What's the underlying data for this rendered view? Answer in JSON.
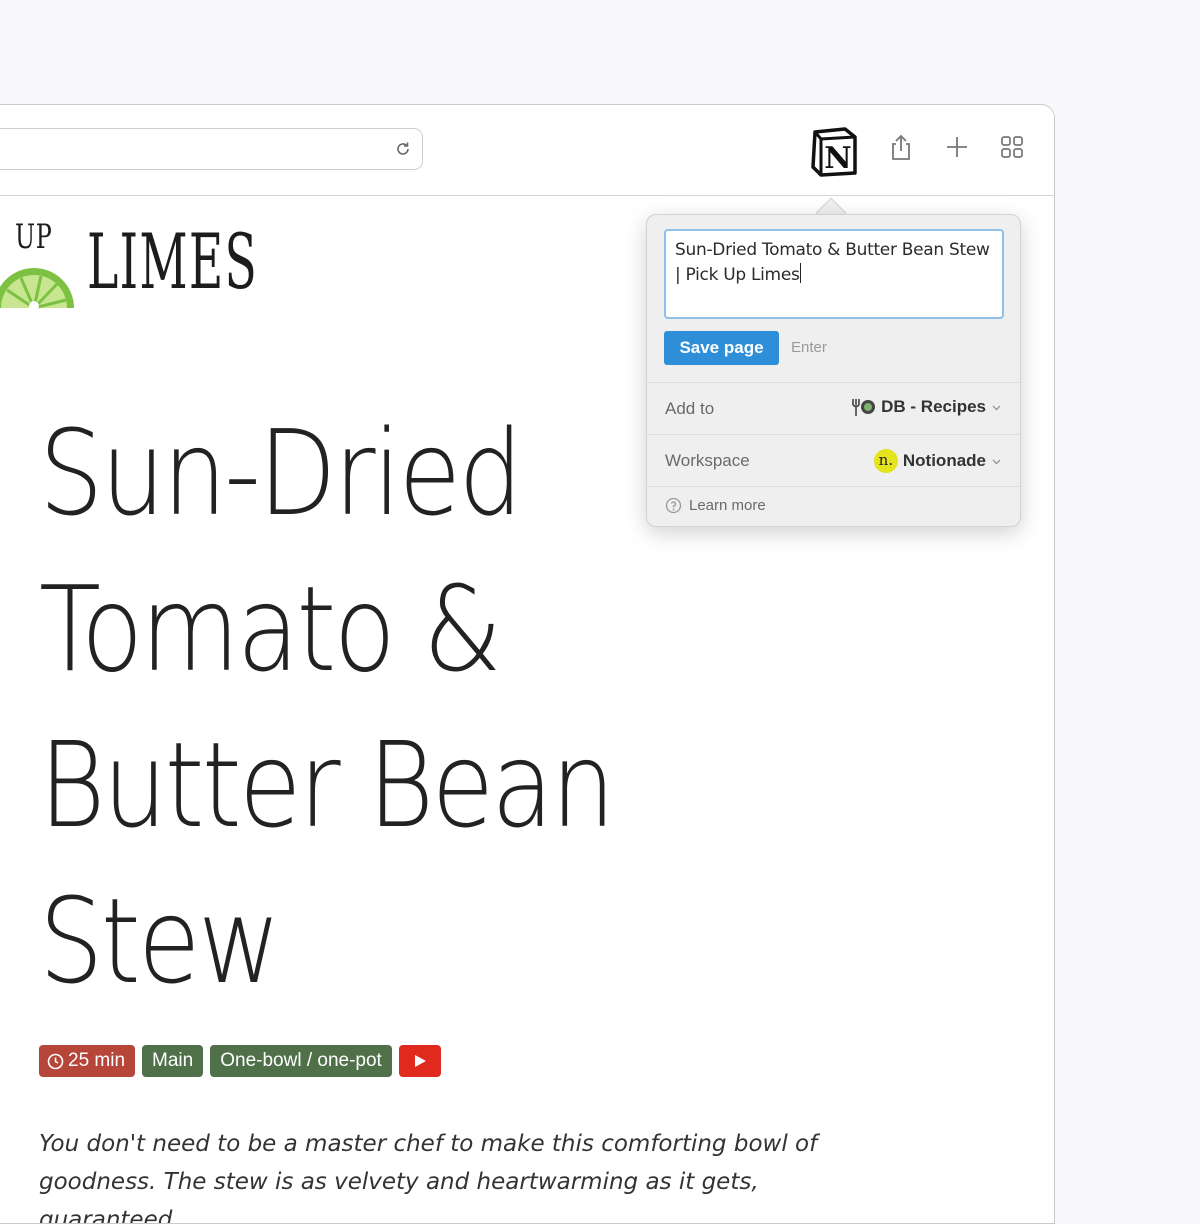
{
  "browser": {
    "toolbar_icons": [
      "reload-icon",
      "notion-icon",
      "share-icon",
      "plus-icon",
      "tab-overview-icon"
    ]
  },
  "page": {
    "logo": {
      "small": "UP",
      "large": "LIMES"
    },
    "title": "Sun-Dried Tomato & Butter Bean Stew",
    "tags": {
      "time": "25 min",
      "course": "Main",
      "style": "One-bowl / one-pot"
    },
    "intro": "You don't need to be a master chef to make this comforting bowl of goodness. The stew is as velvety and heartwarming as it gets, guaranteed"
  },
  "clipper": {
    "title_value": "Sun-Dried Tomato & Butter Bean Stew | Pick Up Limes",
    "save_label": "Save page",
    "enter_hint": "Enter",
    "add_to_label": "Add to",
    "add_to_value": "DB - Recipes",
    "workspace_label": "Workspace",
    "workspace_value": "Notionade",
    "workspace_avatar": "n.",
    "learn_more": "Learn more",
    "colors": {
      "save_button": "#2f8ed8",
      "focus_ring": "#8fc0ea",
      "workspace_avatar": "#e3e41c"
    }
  },
  "colors": {
    "tag_time": "#b6463a",
    "tag_green": "#4f7048",
    "tag_youtube": "#e02a1f"
  }
}
